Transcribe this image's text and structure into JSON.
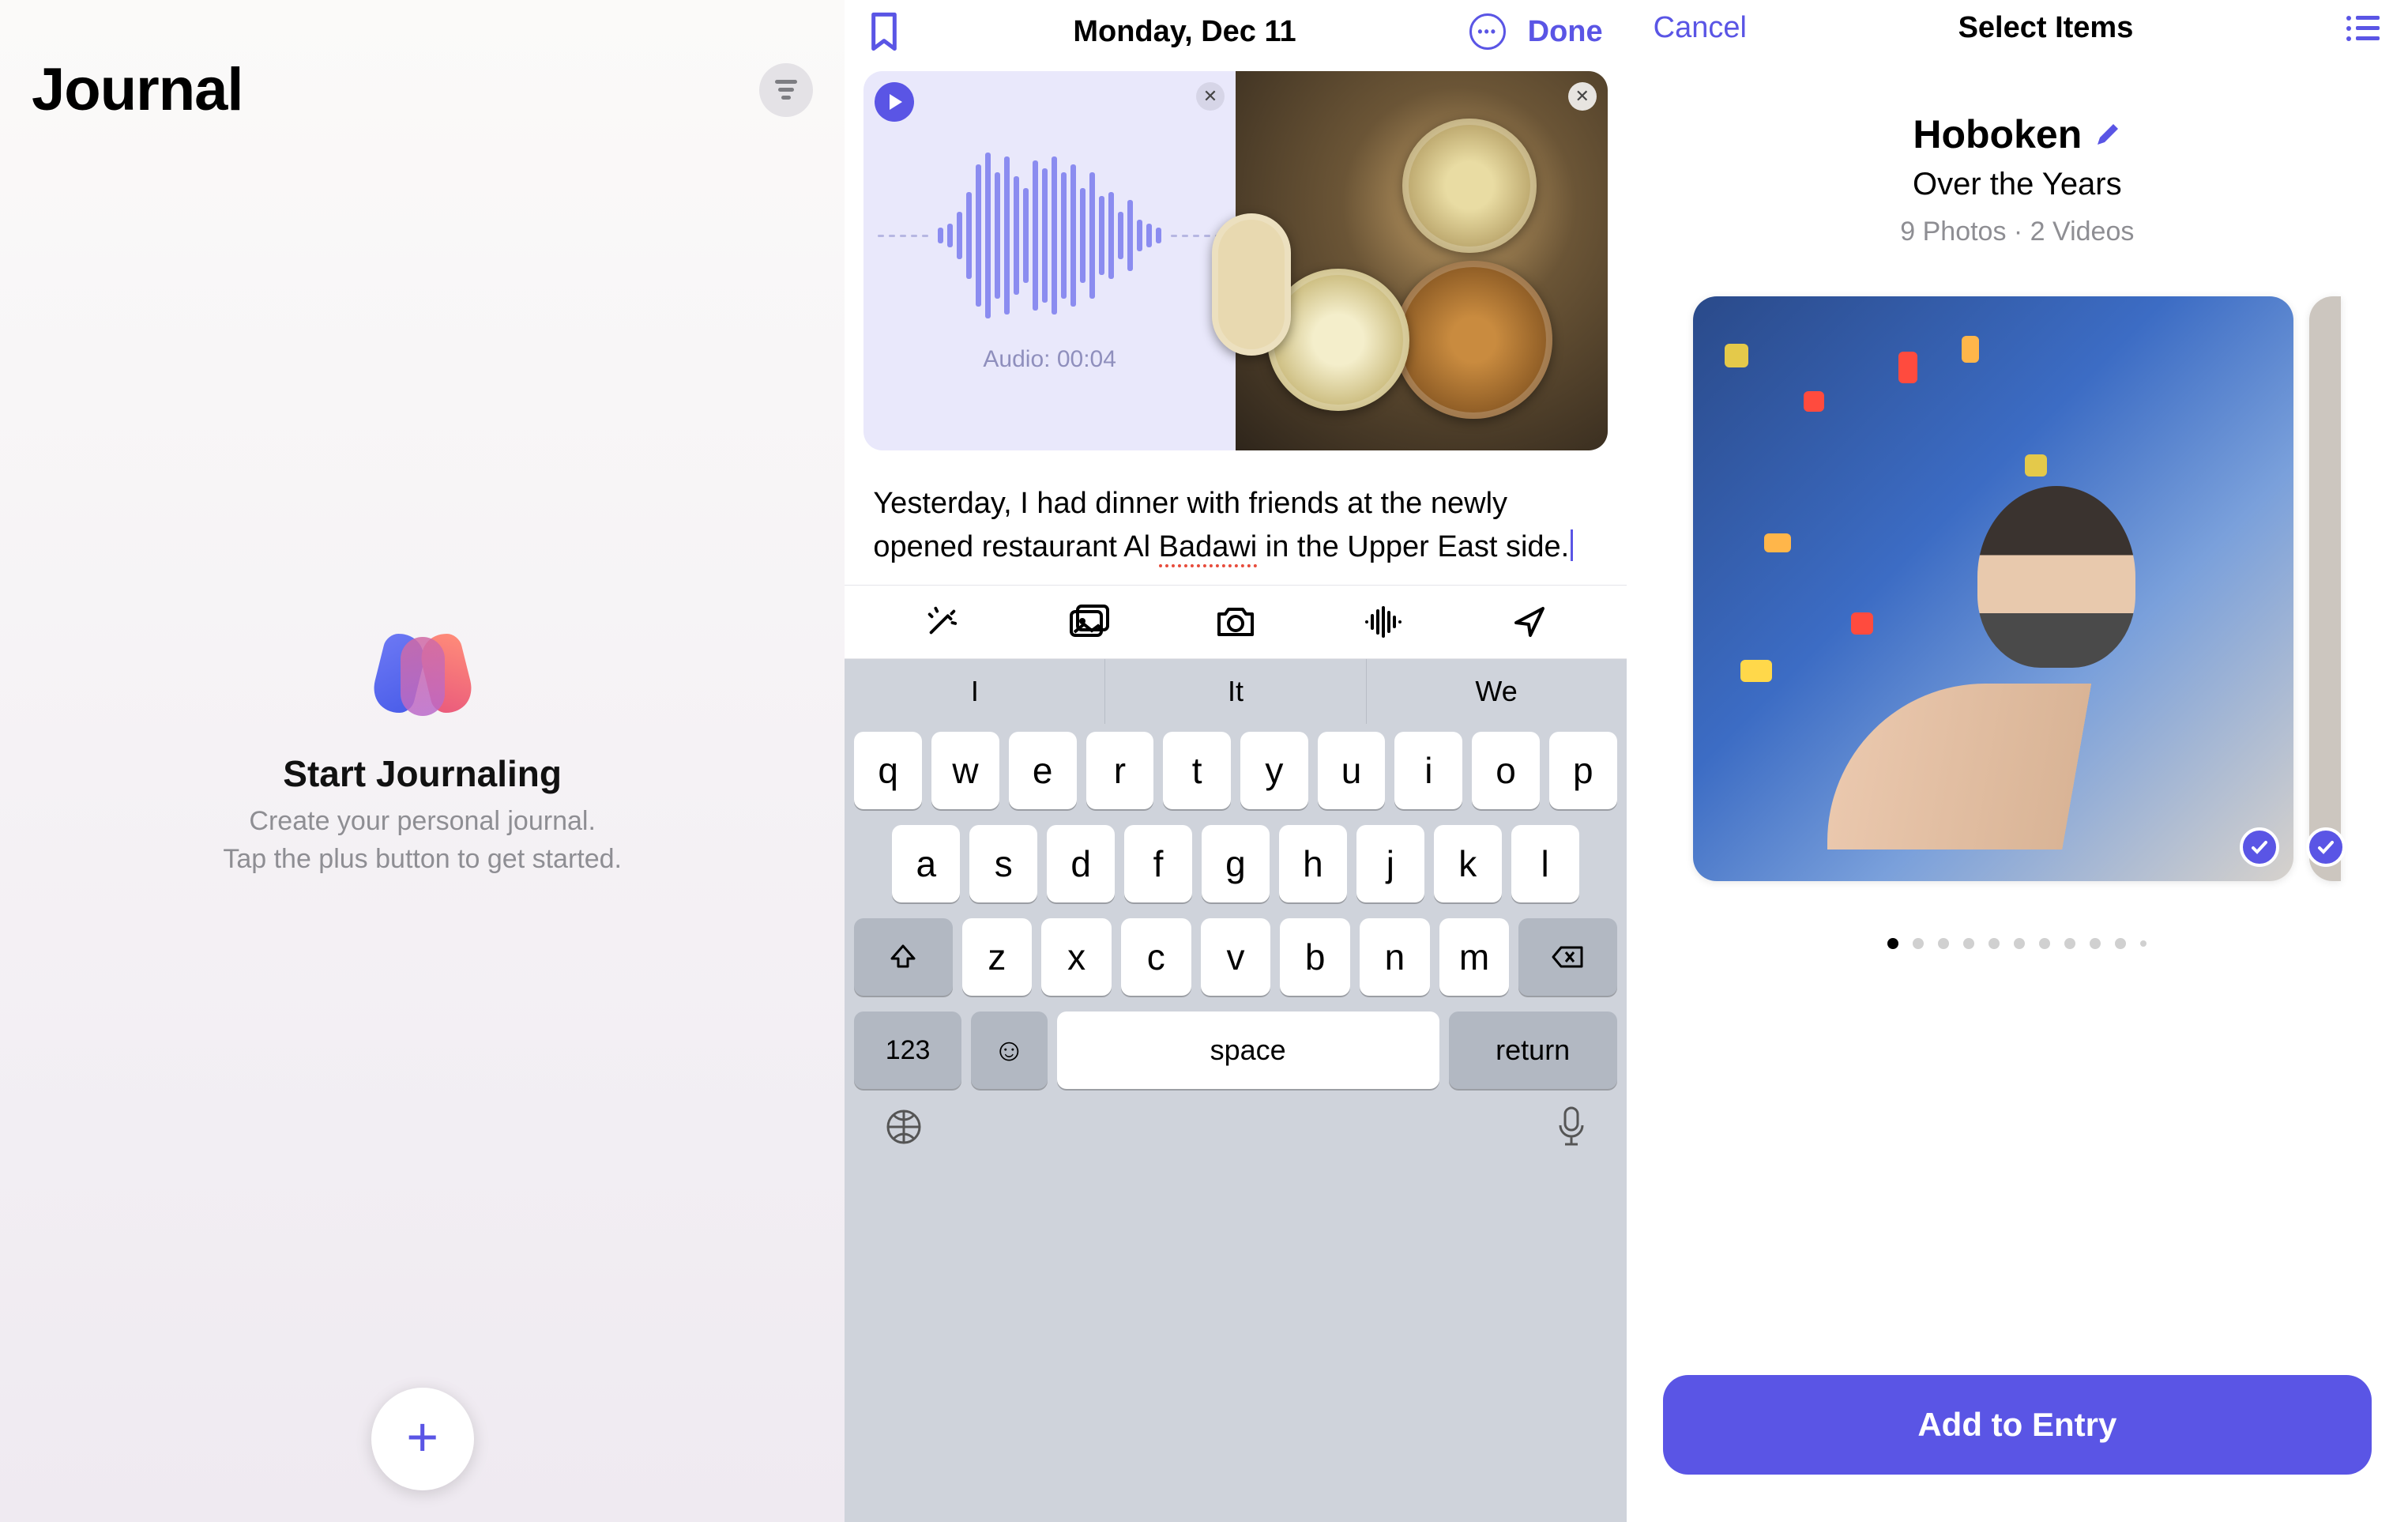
{
  "pane1": {
    "title": "Journal",
    "heading": "Start Journaling",
    "sub_line1": "Create your personal journal.",
    "sub_line2": "Tap the plus button to get started."
  },
  "pane2": {
    "date_title": "Monday, Dec 11",
    "done_label": "Done",
    "audio_label": "Audio: 00:04",
    "entry_text_1": "Yesterday, I had dinner with friends at the newly opened restaurant Al ",
    "entry_text_spellword": "Badawi",
    "entry_text_2": " in the Upper East side.",
    "suggestions": [
      "I",
      "It",
      "We"
    ],
    "keys_row1": [
      "q",
      "w",
      "e",
      "r",
      "t",
      "y",
      "u",
      "i",
      "o",
      "p"
    ],
    "keys_row2": [
      "a",
      "s",
      "d",
      "f",
      "g",
      "h",
      "j",
      "k",
      "l"
    ],
    "keys_row3": [
      "z",
      "x",
      "c",
      "v",
      "b",
      "n",
      "m"
    ],
    "key_123": "123",
    "key_space": "space",
    "key_return": "return"
  },
  "pane3": {
    "cancel_label": "Cancel",
    "title": "Select Items",
    "location_title": "Hoboken",
    "location_subtitle": "Over the Years",
    "media_summary": "9 Photos · 2 Videos",
    "cta_label": "Add to Entry"
  }
}
